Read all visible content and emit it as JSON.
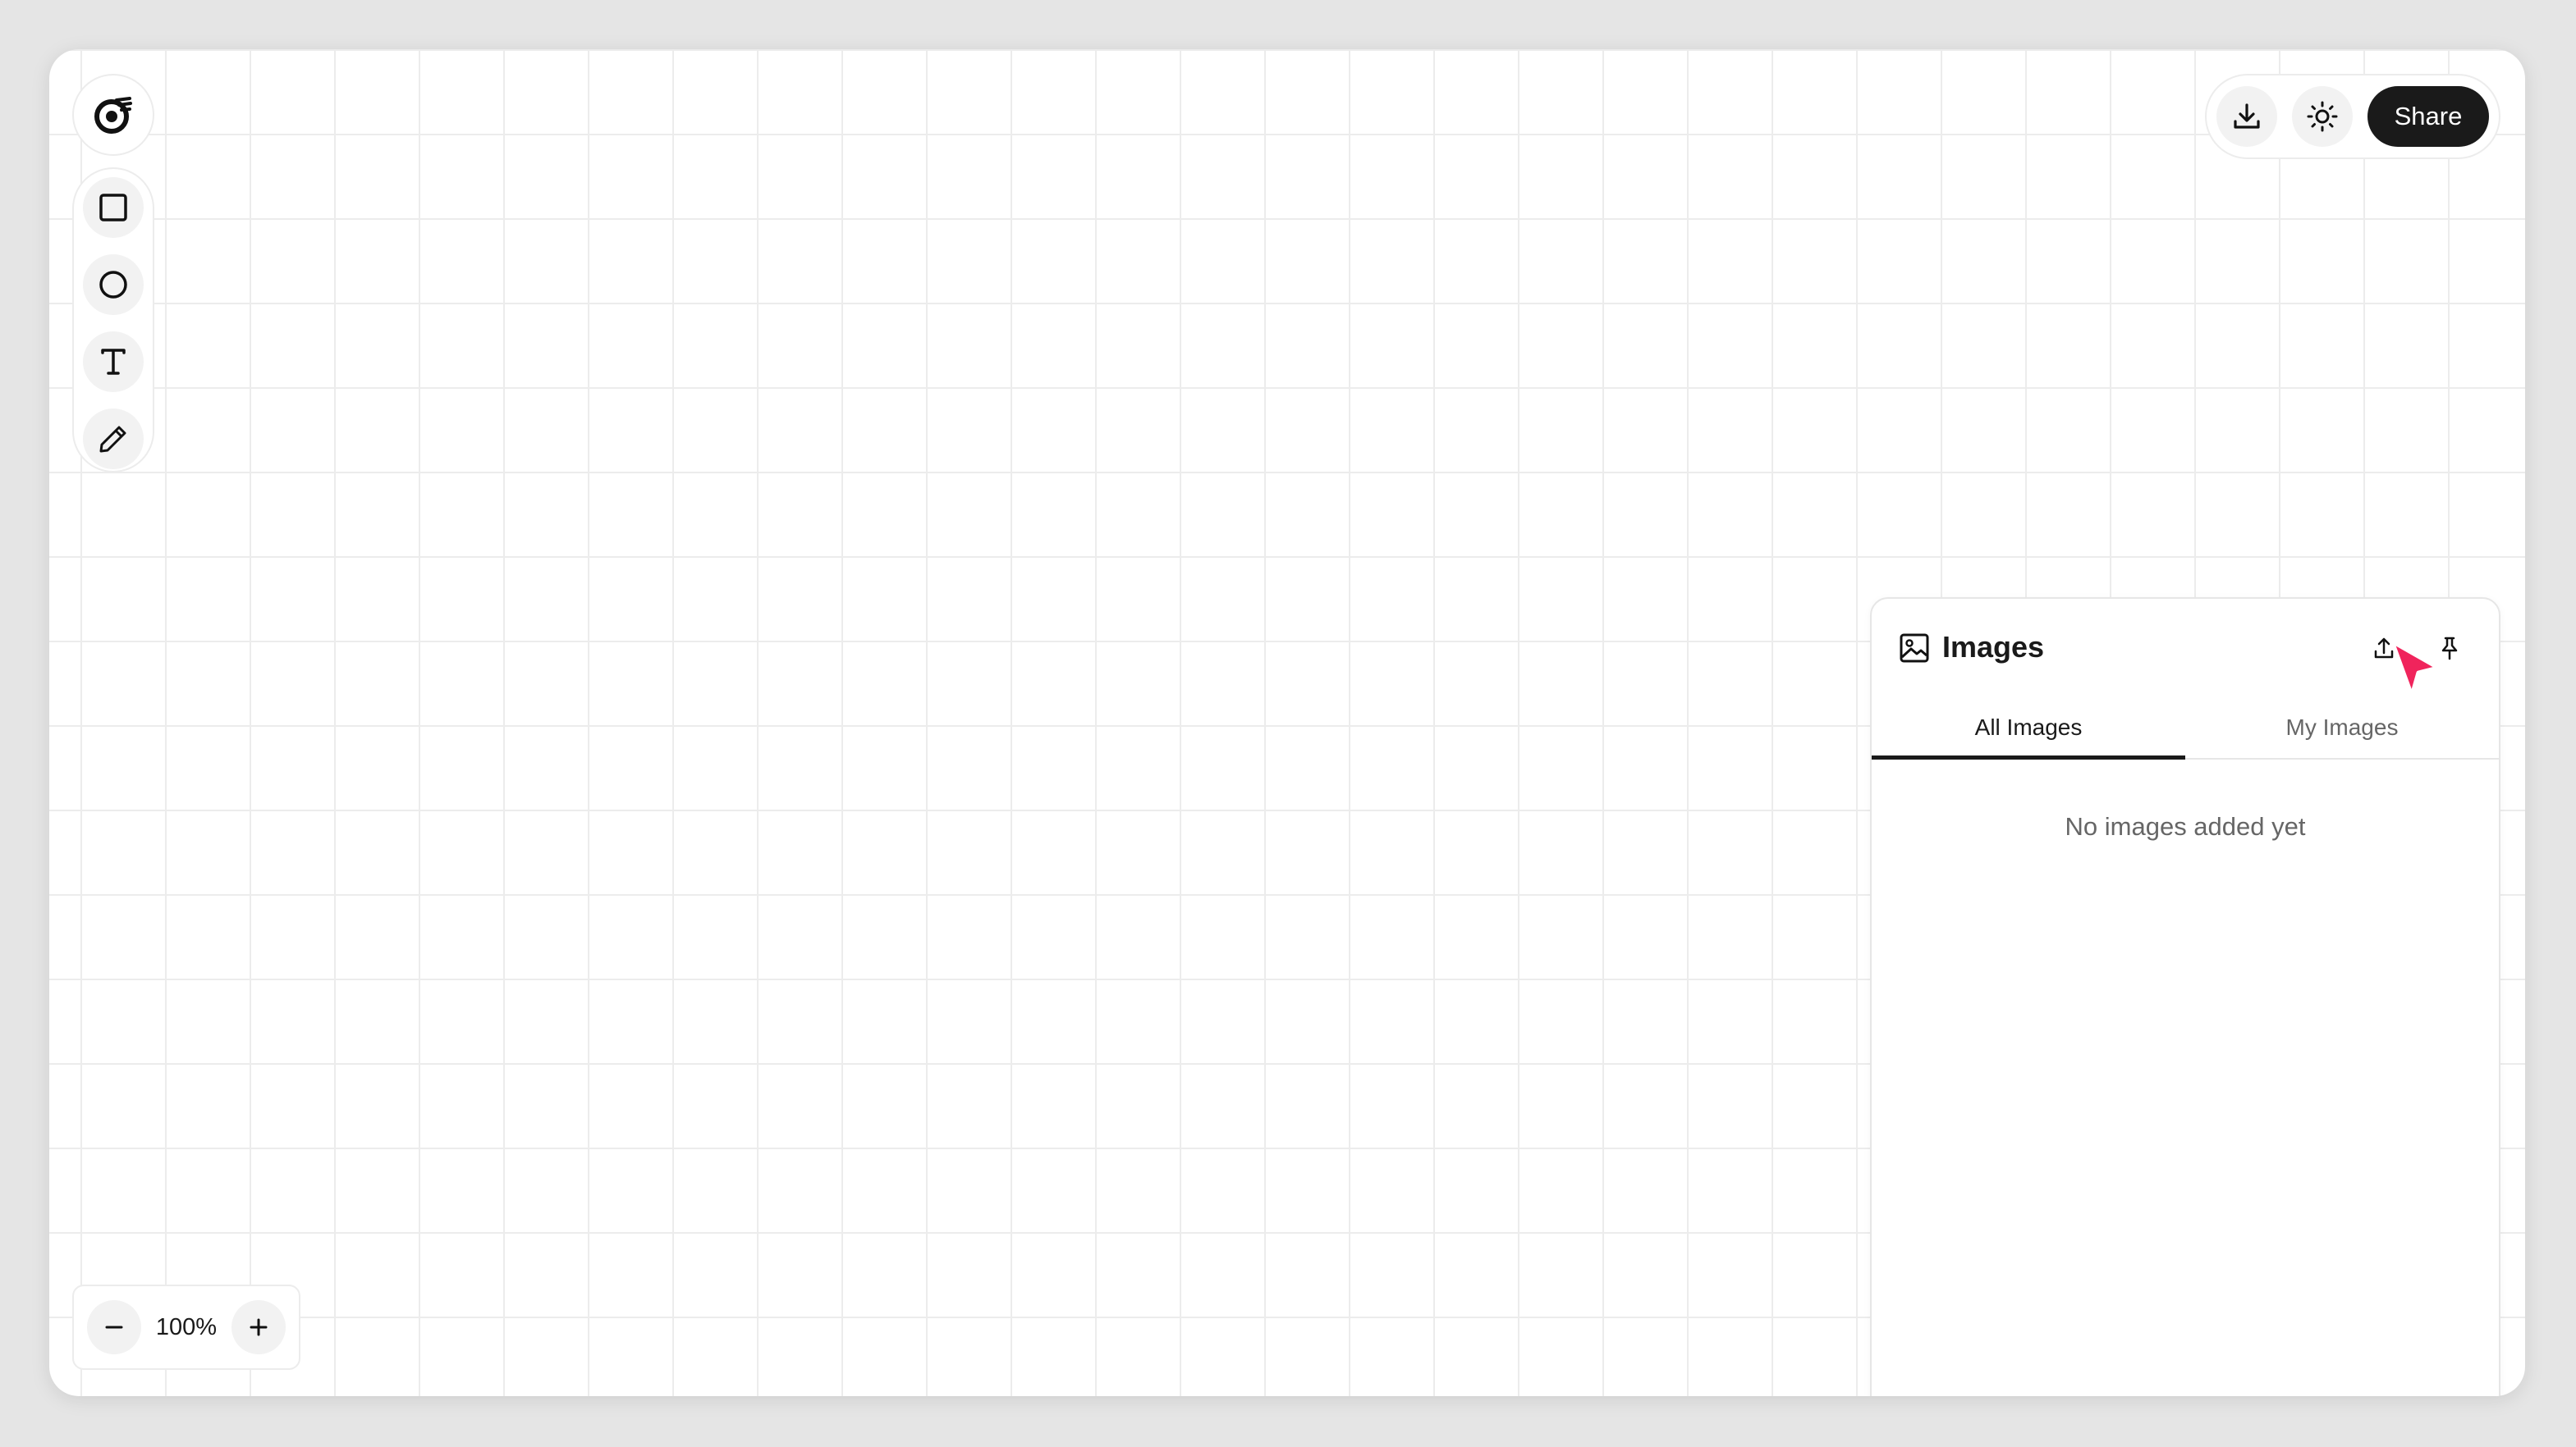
{
  "toolbar": {
    "tools": [
      {
        "name": "square-tool",
        "icon": "square-icon"
      },
      {
        "name": "circle-tool",
        "icon": "circle-icon"
      },
      {
        "name": "text-tool",
        "icon": "text-icon"
      },
      {
        "name": "pen-tool",
        "icon": "pencil-icon"
      }
    ]
  },
  "topbar": {
    "download_icon": "download-icon",
    "theme_icon": "sun-icon",
    "share_label": "Share"
  },
  "zoom": {
    "level": "100%",
    "minus_icon": "minus-icon",
    "plus_icon": "plus-icon"
  },
  "images_panel": {
    "title": "Images",
    "tabs": [
      {
        "label": "All Images",
        "active": true
      },
      {
        "label": "My Images",
        "active": false
      }
    ],
    "empty_message": "No images added yet"
  },
  "colors": {
    "accent_dark": "#1a1a1a",
    "cursor": "#f0245c",
    "grid_line": "#ececec"
  }
}
